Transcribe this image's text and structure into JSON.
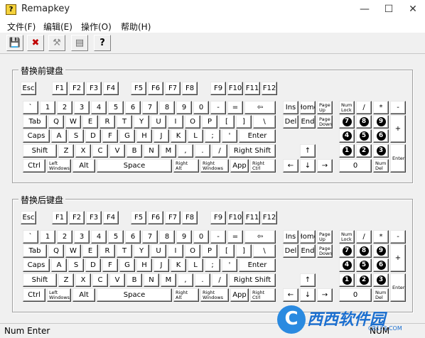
{
  "window": {
    "title": "Remapkey",
    "icon_glyph": "?",
    "minimize": "—",
    "maximize": "☐",
    "close": "✕"
  },
  "menu": [
    {
      "label": "文件(F)"
    },
    {
      "label": "编辑(E)"
    },
    {
      "label": "操作(O)"
    },
    {
      "label": "帮助(H)"
    }
  ],
  "toolbar": [
    {
      "icon": "save-icon",
      "glyph": "💾"
    },
    {
      "icon": "reset-icon",
      "glyph": "✖"
    },
    {
      "icon": "tools-icon",
      "glyph": "⚒"
    },
    {
      "icon": "document-icon",
      "glyph": "▤"
    },
    {
      "icon": "help-icon",
      "glyph": "?"
    }
  ],
  "groups": {
    "before": {
      "title": "替换前键盘"
    },
    "after": {
      "title": "替换后键盘"
    }
  },
  "keys": {
    "esc": "Esc",
    "f1": "F1",
    "f2": "F2",
    "f3": "F3",
    "f4": "F4",
    "f5": "F5",
    "f6": "F6",
    "f7": "F7",
    "f8": "F8",
    "f9": "F9",
    "f10": "F10",
    "f11": "F11",
    "f12": "F12",
    "backtick": "`",
    "d1": "1",
    "d2": "2",
    "d3": "3",
    "d4": "4",
    "d5": "5",
    "d6": "6",
    "d7": "7",
    "d8": "8",
    "d9": "9",
    "d0": "0",
    "minus": "-",
    "equals": "=",
    "backspace": "⇦",
    "tab": "Tab",
    "q": "Q",
    "w": "W",
    "e": "E",
    "r": "R",
    "t": "T",
    "y": "Y",
    "u": "U",
    "i": "I",
    "o": "O",
    "p": "P",
    "lbracket": "[",
    "rbracket": "]",
    "backslash": "\\",
    "caps": "Caps",
    "a": "A",
    "s": "S",
    "d": "D",
    "f": "F",
    "g": "G",
    "h": "H",
    "j": "J",
    "k": "K",
    "l": "L",
    "semicolon": ";",
    "quote": "'",
    "enter": "Enter",
    "lshift": "Shift",
    "z": "Z",
    "x": "X",
    "c": "C",
    "v": "V",
    "b": "B",
    "n": "N",
    "m": "M",
    "comma": ",",
    "period": ".",
    "slash": "/",
    "rshift": "Right Shift",
    "lctrl": "Ctrl",
    "lwin": "Left\nWindows",
    "lalt": "Alt",
    "space": "Space",
    "ralt": "Right\nAlt",
    "rwin": "Right\nWindows",
    "app": "App",
    "rctrl": "Right\nCtrl",
    "ins": "Ins",
    "home": "Home",
    "pgup": "Page\nUp",
    "del": "Del",
    "end": "End",
    "pgdn": "Page\nDown",
    "up": "↑",
    "left": "←",
    "down": "↓",
    "right": "→",
    "numlock": "Num\nLock",
    "npdiv": "/",
    "npmul": "*",
    "npsub": "-",
    "np7": "7",
    "np8": "8",
    "np9": "9",
    "npadd": "+",
    "np4": "4",
    "np5": "5",
    "np6": "6",
    "np1": "1",
    "np2": "2",
    "np3": "3",
    "npenter": "Enter",
    "np0": "0",
    "npdel": "Num\nDel"
  },
  "status": {
    "left": "Num Enter",
    "right": "NUM"
  },
  "watermark": {
    "logo": "C",
    "text": "西西软件园",
    "sub": "CR173.COM"
  }
}
